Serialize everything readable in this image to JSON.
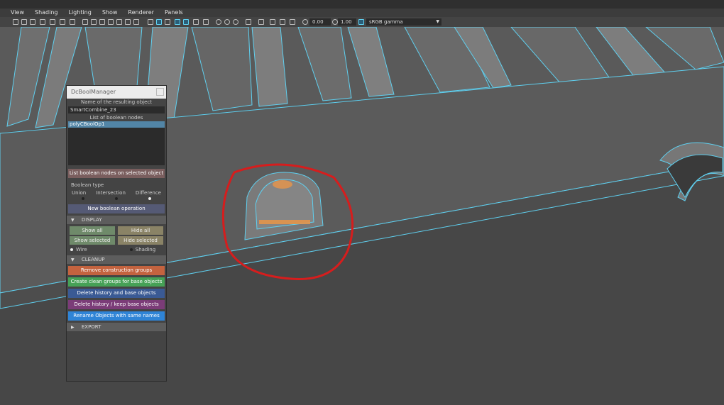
{
  "menu": [
    "View",
    "Shading",
    "Lighting",
    "Show",
    "Renderer",
    "Panels"
  ],
  "toolbar": {
    "exposure": "0.00",
    "gamma": "1.00",
    "color_space": "sRGB gamma"
  },
  "panel": {
    "title": "DcBoolManager",
    "result_label": "Name of the resulting object",
    "result_value": "SmartCombine_23",
    "list_label": "List of boolean nodes",
    "list_items": [
      "polyCBoolOp1"
    ],
    "list_button": "List boolean nodes on selected object",
    "bool_type_label": "Boolean type",
    "bool_types": [
      "Union",
      "Intersection",
      "Difference"
    ],
    "selected_bool_type": "Difference",
    "new_op_button": "New boolean operation",
    "display_header": "DISPLAY",
    "show_all": "Show all",
    "hide_all": "Hide all",
    "show_selected": "Show selected",
    "hide_selected": "Hide selected",
    "wire": "Wire",
    "shading": "Shading",
    "cleanup_header": "CLEANUP",
    "remove_groups": "Remove construction groups",
    "create_groups": "Create clean groups for base objects",
    "delete_history_base": "Delete history and base objects",
    "delete_history_keep": "Delete history / keep base objects",
    "rename_objects": "Rename Objects with same names",
    "export_header": "EXPORT"
  },
  "colors": {
    "remove_groups": "#c4633f",
    "create_groups": "#46a156",
    "delete_history_base": "#3a5a94",
    "delete_history_keep": "#7b3c78",
    "rename_objects": "#2f84d6",
    "highlight_circle": "#d61d1d",
    "wire_edge": "#5fd0f0"
  }
}
